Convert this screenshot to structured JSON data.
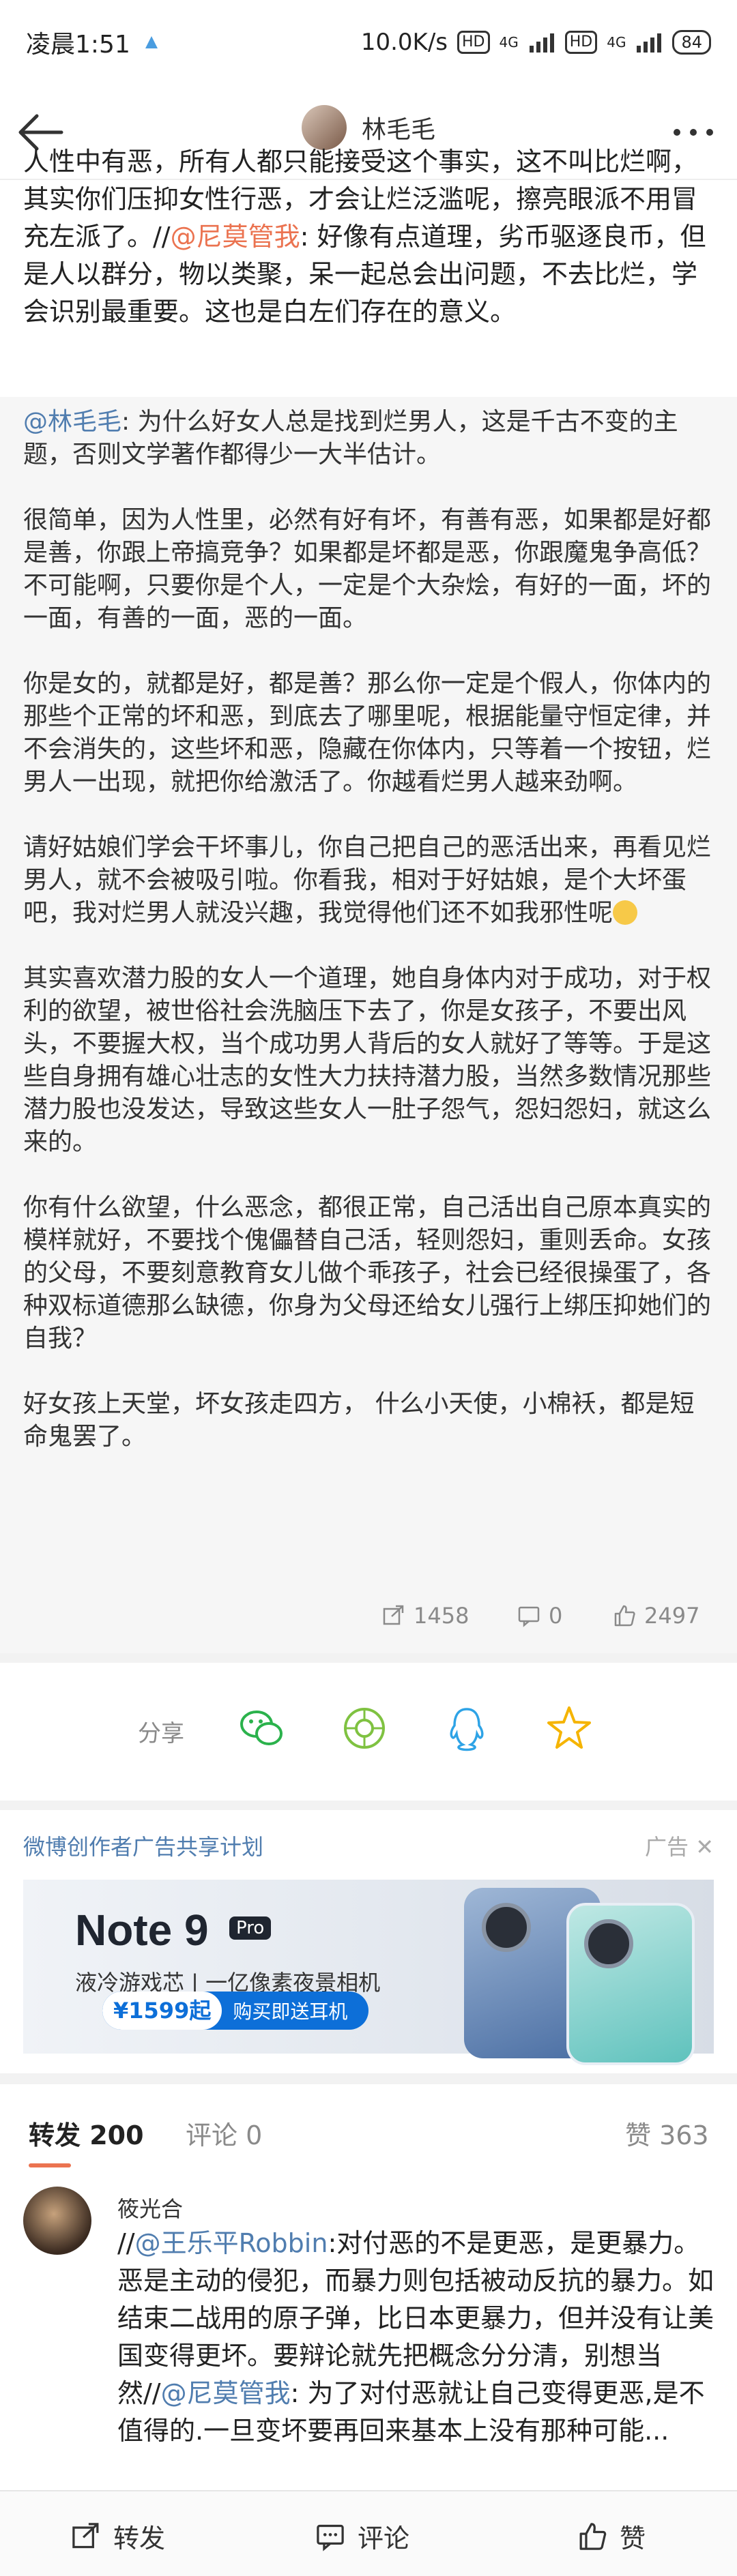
{
  "status_bar": {
    "time": "凌晨1:51",
    "net_speed": "10.0K/s",
    "hd1": "HD",
    "signal1": "4G",
    "hd2": "HD",
    "signal2": "4G",
    "battery": "84"
  },
  "header": {
    "user_name": "林毛毛"
  },
  "post": {
    "text_before": "人性中有恶，所有人都只能接受这个事实，这不叫比烂啊，其实你们压抑女性行恶，才会让烂泛滥呢，擦亮眼派不用冒充左派了。//",
    "mention": "@尼莫管我",
    "text_after": ": 好像有点道理，劣币驱逐良币，但是人以群分，物以类聚，呆一起总会出问题，不去比烂，学会识别最重要。这也是白左们存在的意义。"
  },
  "quoted": {
    "mention": "@林毛毛",
    "intro": ": 为什么好女人总是找到烂男人，这是千古不变的主题，否则文学著作都得少一大半估计。",
    "p1": "很简单，因为人性里，必然有好有坏，有善有恶，如果都是好都是善，你跟上帝搞竞争？如果都是坏都是恶，你跟魔鬼争高低？不可能啊，只要你是个人，一定是个大杂烩，有好的一面，坏的一面，有善的一面，恶的一面。",
    "p2": "你是女的，就都是好，都是善？那么你一定是个假人，你体内的那些个正常的坏和恶，到底去了哪里呢，根据能量守恒定律，并不会消失的，这些坏和恶，隐藏在你体内，只等着一个按钮，烂男人一出现，就把你给激活了。你越看烂男人越来劲啊。",
    "p3": "请好姑娘们学会干坏事儿，你自己把自己的恶活出来，再看见烂男人，就不会被吸引啦。你看我，相对于好姑娘，是个大坏蛋吧，我对烂男人就没兴趣，我觉得他们还不如我邪性呢",
    "p4": "其实喜欢潜力股的女人一个道理，她自身体内对于成功，对于权利的欲望，被世俗社会洗脑压下去了，你是女孩子，不要出风头，不要握大权，当个成功男人背后的女人就好了等等。于是这些自身拥有雄心壮志的女性大力扶持潜力股，当然多数情况那些潜力股也没发达，导致这些女人一肚子怨气，怨妇怨妇，就这么来的。",
    "p5": "你有什么欲望，什么恶念，都很正常，自己活出自己原本真实的模样就好，不要找个傀儡替自己活，轻则怨妇，重则丢命。女孩的父母，不要刻意教育女儿做个乖孩子，社会已经很操蛋了，各种双标道德那么缺德，你身为父母还给女儿强行上绑压抑她们的自我？",
    "p6": "好女孩上天堂，坏女孩走四方， 什么小天使，小棉袄，都是短命鬼罢了。",
    "stats": {
      "reposts": "1458",
      "comments": "0",
      "likes": "2497"
    },
    "icons": [
      "repost-icon",
      "comment-icon",
      "like-icon"
    ]
  },
  "share": {
    "label": "分享",
    "targets": [
      "wechat-icon",
      "moments-icon",
      "qq-icon",
      "qzone-icon"
    ]
  },
  "ad": {
    "program_title": "微博创作者广告共享计划",
    "tag": "广告",
    "brand": "Note 9",
    "brand_badge": "Pro",
    "subtitle": "液冷游戏芯 | 一亿像素夜景相机",
    "price": "¥1599起",
    "cta": "购买即送耳机"
  },
  "tabs": [
    {
      "label": "转发 200",
      "active": true
    },
    {
      "label": "评论 0",
      "active": false
    },
    {
      "label": "赞 363",
      "active": false
    }
  ],
  "comment": {
    "author": "筱光合",
    "prefix": "//",
    "mention1": "@王乐平Robbin",
    "text1": ":对付恶的不是更恶，是更暴力。恶是主动的侵犯，而暴力则包括被动反抗的暴力。如结束二战用的原子弹，比日本更暴力，但并没有让美国变得更坏。要辩论就先把概念分分清，别想当然//",
    "mention2": "@尼莫管我",
    "text2": ": 为了对付恶就让自己变得更恶,是不值得的.一旦变坏要再回来基本上没有那种可能..."
  },
  "bottom_bar": {
    "repost": "转发",
    "comment": "评论",
    "like": "赞"
  },
  "colors": {
    "accent": "#eb7350",
    "link_blue": "#507daf",
    "quote_bg": "#f6f6f6"
  }
}
